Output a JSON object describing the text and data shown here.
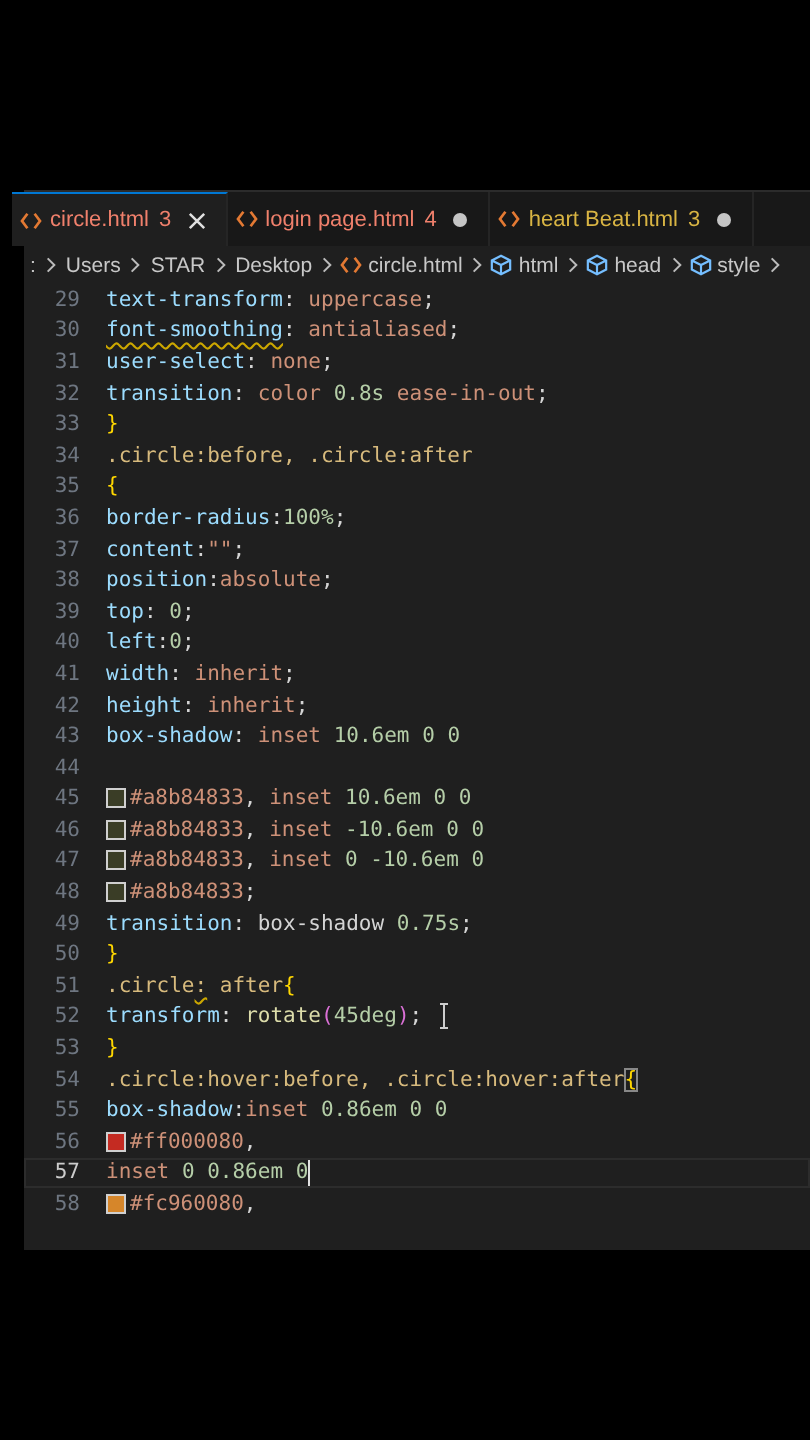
{
  "tabs": [
    {
      "label": "circle.html",
      "count": "3",
      "color": "#f0806c",
      "selected": true,
      "modified": false
    },
    {
      "label": "login page.html",
      "count": "4",
      "color": "#f0806c",
      "selected": false,
      "modified": true
    },
    {
      "label": "heart Beat.html",
      "count": "3",
      "color": "#d8b443",
      "selected": false,
      "modified": true
    }
  ],
  "breadcrumbs": [
    {
      "label": ":",
      "kind": "folder"
    },
    {
      "label": "Users",
      "kind": "folder"
    },
    {
      "label": "STAR",
      "kind": "folder"
    },
    {
      "label": "Desktop",
      "kind": "folder"
    },
    {
      "label": "circle.html",
      "kind": "file"
    },
    {
      "label": "html",
      "kind": "symbol"
    },
    {
      "label": "head",
      "kind": "symbol"
    },
    {
      "label": "style",
      "kind": "symbol"
    }
  ],
  "lines": [
    {
      "number": "29",
      "current": false,
      "tokens": [
        {
          "text": "text-transform",
          "kind": "prop"
        },
        {
          "text": ": ",
          "kind": "punct"
        },
        {
          "text": "uppercase",
          "kind": "value"
        },
        {
          "text": ";",
          "kind": "punct"
        }
      ]
    },
    {
      "number": "30",
      "current": false,
      "tokens": [
        {
          "text": "font-smoothing",
          "kind": "prop",
          "squiggle": true
        },
        {
          "text": ": ",
          "kind": "punct"
        },
        {
          "text": "antialiased",
          "kind": "value"
        },
        {
          "text": ";",
          "kind": "punct"
        }
      ]
    },
    {
      "number": "31",
      "current": false,
      "tokens": [
        {
          "text": "user-select",
          "kind": "prop"
        },
        {
          "text": ": ",
          "kind": "punct"
        },
        {
          "text": "none",
          "kind": "value"
        },
        {
          "text": ";",
          "kind": "punct"
        }
      ]
    },
    {
      "number": "32",
      "current": false,
      "tokens": [
        {
          "text": "transition",
          "kind": "prop"
        },
        {
          "text": ": ",
          "kind": "punct"
        },
        {
          "text": "color ",
          "kind": "value"
        },
        {
          "text": "0.8s ",
          "kind": "num"
        },
        {
          "text": "ease-in-out",
          "kind": "value"
        },
        {
          "text": ";",
          "kind": "punct"
        }
      ]
    },
    {
      "number": "33",
      "current": false,
      "tokens": [
        {
          "text": "}",
          "kind": "brace"
        }
      ]
    },
    {
      "number": "34",
      "current": false,
      "tokens": [
        {
          "text": ".circle:before, .circle:after",
          "kind": "selector"
        }
      ]
    },
    {
      "number": "35",
      "current": false,
      "tokens": [
        {
          "text": "{",
          "kind": "brace"
        }
      ]
    },
    {
      "number": "36",
      "current": false,
      "tokens": [
        {
          "text": "border-radius",
          "kind": "prop"
        },
        {
          "text": ":",
          "kind": "punct"
        },
        {
          "text": "100%",
          "kind": "num"
        },
        {
          "text": ";",
          "kind": "punct"
        }
      ]
    },
    {
      "number": "37",
      "current": false,
      "tokens": [
        {
          "text": "content",
          "kind": "prop"
        },
        {
          "text": ":",
          "kind": "punct"
        },
        {
          "text": "\"\"",
          "kind": "string"
        },
        {
          "text": ";",
          "kind": "punct"
        }
      ]
    },
    {
      "number": "38",
      "current": false,
      "tokens": [
        {
          "text": "position",
          "kind": "prop"
        },
        {
          "text": ":",
          "kind": "punct"
        },
        {
          "text": "absolute",
          "kind": "value"
        },
        {
          "text": ";",
          "kind": "punct"
        }
      ]
    },
    {
      "number": "39",
      "current": false,
      "tokens": [
        {
          "text": "top",
          "kind": "prop"
        },
        {
          "text": ": ",
          "kind": "punct"
        },
        {
          "text": "0",
          "kind": "num"
        },
        {
          "text": ";",
          "kind": "punct"
        }
      ]
    },
    {
      "number": "40",
      "current": false,
      "tokens": [
        {
          "text": "left",
          "kind": "prop"
        },
        {
          "text": ":",
          "kind": "punct"
        },
        {
          "text": "0",
          "kind": "num"
        },
        {
          "text": ";",
          "kind": "punct"
        }
      ]
    },
    {
      "number": "41",
      "current": false,
      "tokens": [
        {
          "text": "width",
          "kind": "prop"
        },
        {
          "text": ": ",
          "kind": "punct"
        },
        {
          "text": "inherit",
          "kind": "value"
        },
        {
          "text": ";",
          "kind": "punct"
        }
      ]
    },
    {
      "number": "42",
      "current": false,
      "tokens": [
        {
          "text": "height",
          "kind": "prop"
        },
        {
          "text": ": ",
          "kind": "punct"
        },
        {
          "text": "inherit",
          "kind": "value"
        },
        {
          "text": ";",
          "kind": "punct"
        }
      ]
    },
    {
      "number": "43",
      "current": false,
      "tokens": [
        {
          "text": "box-shadow",
          "kind": "prop"
        },
        {
          "text": ": ",
          "kind": "punct"
        },
        {
          "text": "inset ",
          "kind": "value"
        },
        {
          "text": "10.6em 0 0",
          "kind": "num"
        }
      ]
    },
    {
      "number": "44",
      "current": false
    },
    {
      "number": "45",
      "current": false,
      "color": "#3a3d26",
      "tokens": [
        {
          "text": "#a8b84833",
          "kind": "value"
        },
        {
          "text": ", ",
          "kind": "punct"
        },
        {
          "text": "inset ",
          "kind": "value"
        },
        {
          "text": "10.6em 0 0",
          "kind": "num"
        }
      ]
    },
    {
      "number": "46",
      "current": false,
      "color": "#3a3d26",
      "tokens": [
        {
          "text": "#a8b84833",
          "kind": "value"
        },
        {
          "text": ", ",
          "kind": "punct"
        },
        {
          "text": "inset ",
          "kind": "value"
        },
        {
          "text": "-10.6em 0 0",
          "kind": "num"
        }
      ]
    },
    {
      "number": "47",
      "current": false,
      "color": "#3a3d26",
      "tokens": [
        {
          "text": "#a8b84833",
          "kind": "value"
        },
        {
          "text": ", ",
          "kind": "punct"
        },
        {
          "text": "inset ",
          "kind": "value"
        },
        {
          "text": "0 -10.6em 0",
          "kind": "num"
        }
      ]
    },
    {
      "number": "48",
      "current": false,
      "color": "#3a3d26",
      "tokens": [
        {
          "text": "#a8b84833",
          "kind": "value"
        },
        {
          "text": ";",
          "kind": "punct"
        }
      ]
    },
    {
      "number": "49",
      "current": false,
      "tokens": [
        {
          "text": "transition",
          "kind": "prop"
        },
        {
          "text": ": box-shadow ",
          "kind": "punct"
        },
        {
          "text": "0.75s",
          "kind": "num"
        },
        {
          "text": ";",
          "kind": "punct"
        }
      ]
    },
    {
      "number": "50",
      "current": false,
      "tokens": [
        {
          "text": "}",
          "kind": "brace"
        }
      ]
    },
    {
      "number": "51",
      "current": false,
      "tokens": [
        {
          "text": ".circle",
          "kind": "selector"
        },
        {
          "text": ":",
          "kind": "selector",
          "squiggle": true
        },
        {
          "text": " after",
          "kind": "selector"
        },
        {
          "text": "{",
          "kind": "brace"
        }
      ]
    },
    {
      "number": "52",
      "current": false,
      "pointer": true,
      "tokens": [
        {
          "text": "transform",
          "kind": "prop"
        },
        {
          "text": ": ",
          "kind": "punct"
        },
        {
          "text": "rotate",
          "kind": "func"
        },
        {
          "text": "(",
          "kind": "paren"
        },
        {
          "text": "45deg",
          "kind": "num"
        },
        {
          "text": ")",
          "kind": "paren"
        },
        {
          "text": ";",
          "kind": "punct"
        }
      ]
    },
    {
      "number": "53",
      "current": false,
      "tokens": [
        {
          "text": "}",
          "kind": "brace"
        }
      ]
    },
    {
      "number": "54",
      "current": false,
      "tokens": [
        {
          "text": ".circle:hover:before, .circle:hover:after",
          "kind": "selector"
        },
        {
          "text": "{",
          "kind": "brace",
          "matched": true
        }
      ]
    },
    {
      "number": "55",
      "current": false,
      "tokens": [
        {
          "text": "box-shadow",
          "kind": "prop"
        },
        {
          "text": ":",
          "kind": "punct"
        },
        {
          "text": "inset ",
          "kind": "value"
        },
        {
          "text": "0.86em 0 0",
          "kind": "num"
        }
      ]
    },
    {
      "number": "56",
      "current": false,
      "color": "#c42b22",
      "tokens": [
        {
          "text": "#ff000080",
          "kind": "value"
        },
        {
          "text": ",",
          "kind": "punct"
        }
      ]
    },
    {
      "number": "57",
      "current": true,
      "tokens": [
        {
          "text": "inset ",
          "kind": "value"
        },
        {
          "text": "0 0.86em 0",
          "kind": "num"
        }
      ]
    },
    {
      "number": "58",
      "current": false,
      "color": "#d6862a",
      "tokens": [
        {
          "text": "#fc960080",
          "kind": "value"
        },
        {
          "text": ",",
          "kind": "punct"
        }
      ]
    }
  ]
}
